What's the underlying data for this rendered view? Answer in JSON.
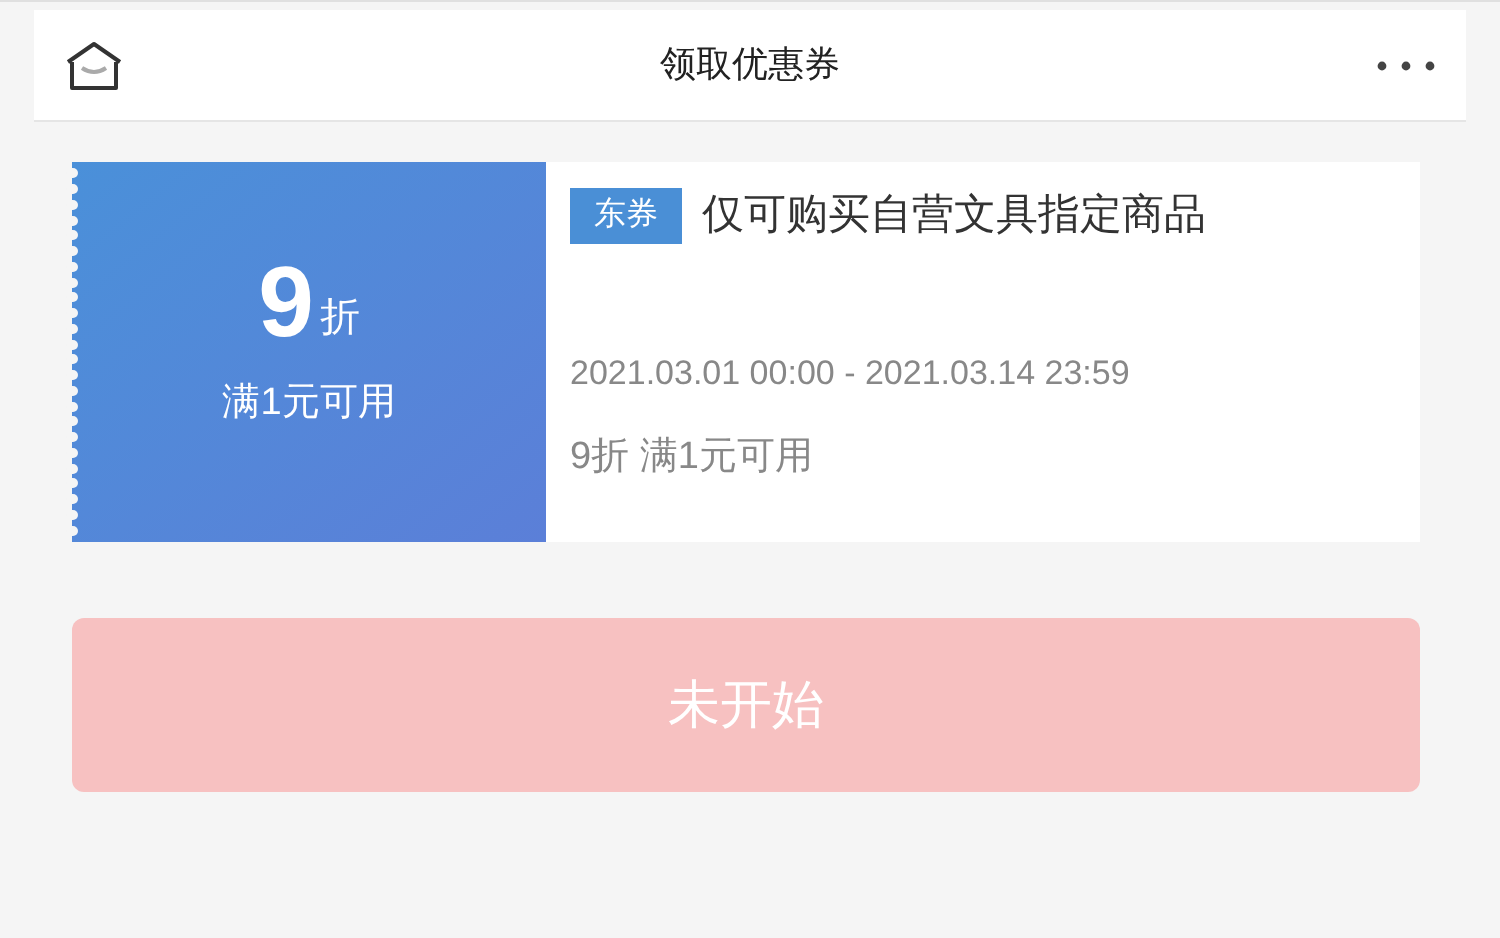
{
  "header": {
    "title": "领取优惠券"
  },
  "coupon": {
    "amount": "9",
    "unit": "折",
    "condition": "满1元可用",
    "tag": "东券",
    "description": "仅可购买自营文具指定商品",
    "validity": "2021.03.01 00:00 - 2021.03.14 23:59",
    "summary": "9折 满1元可用"
  },
  "action_button": {
    "label": "未开始",
    "disabled": true
  }
}
